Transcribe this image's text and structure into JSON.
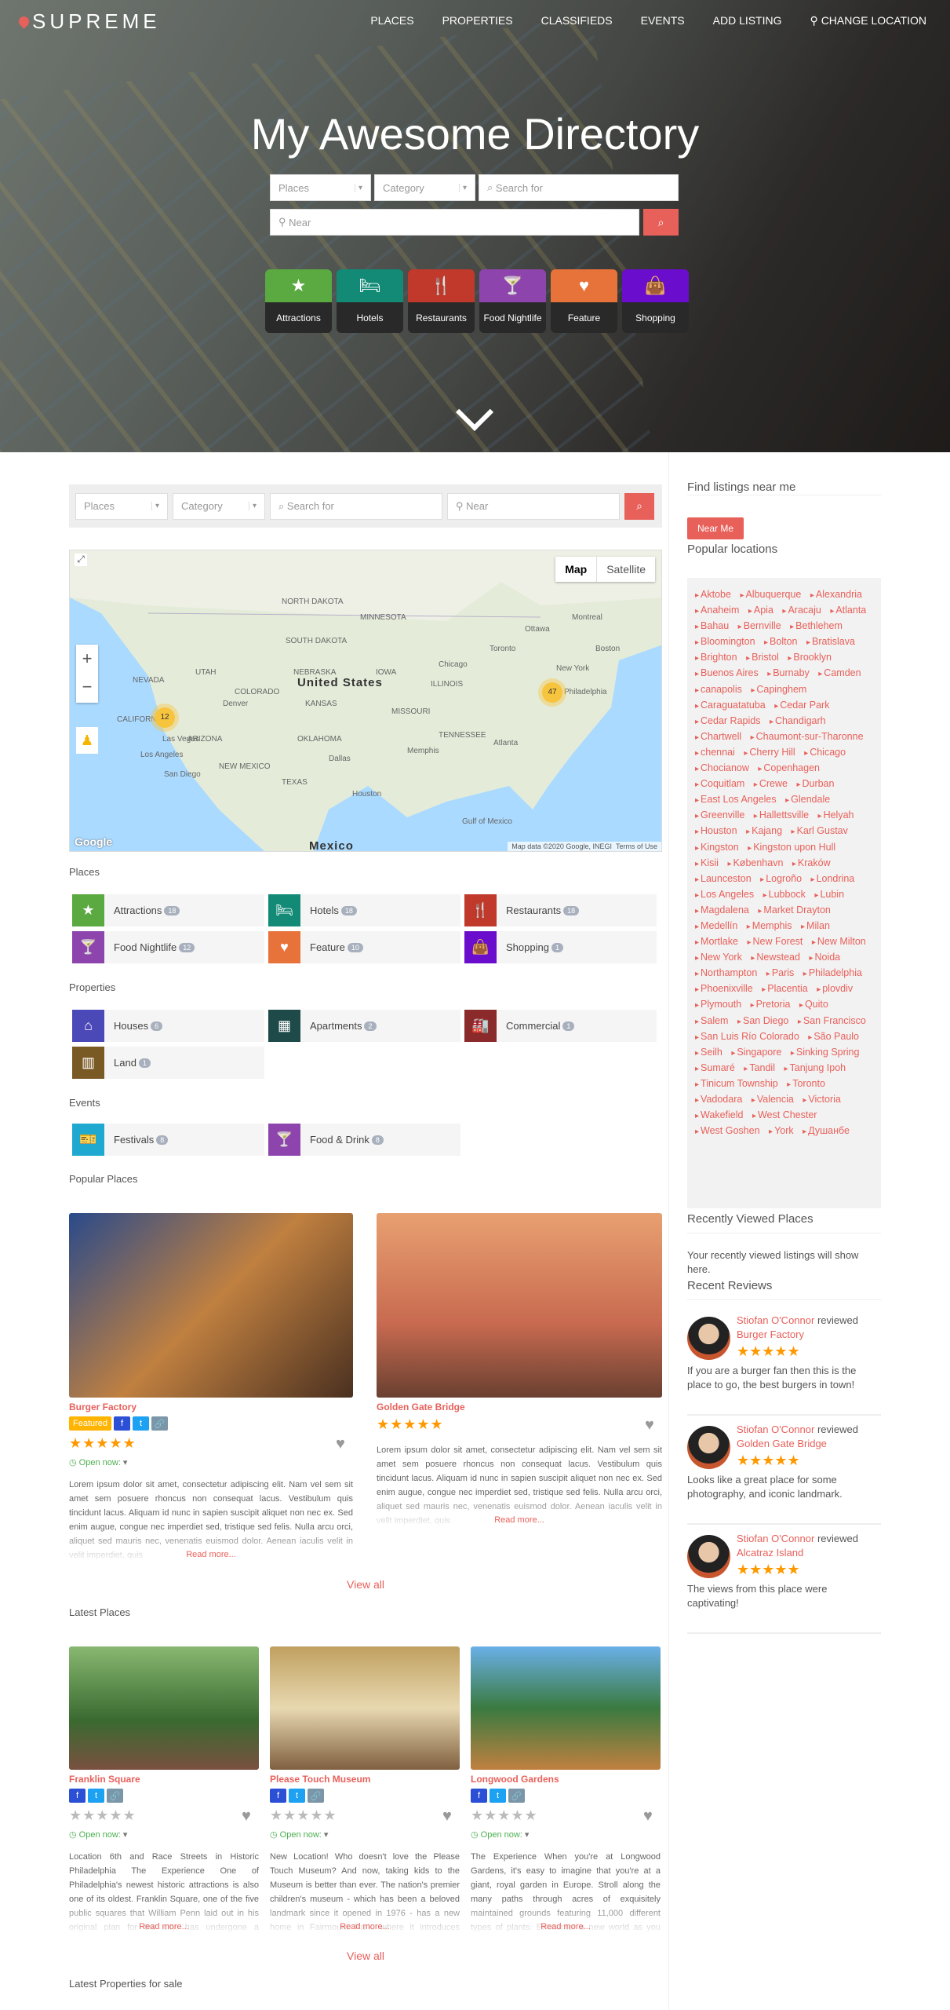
{
  "header": {
    "logo": "SUPREME",
    "nav": [
      "PLACES",
      "PROPERTIES",
      "CLASSIFIEDS",
      "EVENTS",
      "ADD LISTING",
      "CHANGE LOCATION"
    ]
  },
  "hero": {
    "title": "My Awesome Directory",
    "post_type": "Places",
    "category": "Category",
    "search_placeholder": "Search for",
    "near_placeholder": "Near",
    "tiles": [
      {
        "label": "Attractions",
        "icon": "star-icon",
        "color": "#5aa941"
      },
      {
        "label": "Hotels",
        "icon": "bed-icon",
        "color": "#128a76"
      },
      {
        "label": "Restaurants",
        "icon": "utensils-icon",
        "color": "#c0392b"
      },
      {
        "label": "Food Nightlife",
        "icon": "cocktail-icon",
        "color": "#8e44ad"
      },
      {
        "label": "Feature",
        "icon": "heart-icon",
        "color": "#e8733a"
      },
      {
        "label": "Shopping",
        "icon": "shopping-bag-icon",
        "color": "#6a0dcc"
      }
    ]
  },
  "search": {
    "post_type": "Places",
    "category": "Category",
    "search_placeholder": "Search for",
    "near_placeholder": "Near"
  },
  "map": {
    "type_map": "Map",
    "type_satellite": "Satellite",
    "clusters": [
      "12",
      "47"
    ],
    "labels": [
      "United States",
      "Mexico",
      "NORTH DAKOTA",
      "SOUTH DAKOTA",
      "NEBRASKA",
      "KANSAS",
      "OKLAHOMA",
      "TEXAS",
      "NEVADA",
      "UTAH",
      "COLORADO",
      "CALIFORNIA",
      "ARIZONA",
      "NEW MEXICO",
      "MINNESOTA",
      "IOWA",
      "MISSOURI",
      "ILLINOIS",
      "TENNESSEE",
      "Chicago",
      "Toronto",
      "Ottawa",
      "Montreal",
      "Denver",
      "Las Vegas",
      "Los Angeles",
      "San Diego",
      "Dallas",
      "Houston",
      "Atlanta",
      "Memphis",
      "Boston",
      "New York",
      "Philadelphia",
      "Gulf of Mexico"
    ],
    "attribution": "Map data ©2020 Google, INEGI",
    "terms": "Terms of Use",
    "google": "Google"
  },
  "places": {
    "label": "Places",
    "items": [
      {
        "name": "Attractions",
        "count": "18",
        "icon": "star-icon",
        "color": "#5aa941"
      },
      {
        "name": "Hotels",
        "count": "18",
        "icon": "bed-icon",
        "color": "#128a76"
      },
      {
        "name": "Restaurants",
        "count": "18",
        "icon": "utensils-icon",
        "color": "#c0392b"
      },
      {
        "name": "Food Nightlife",
        "count": "12",
        "icon": "cocktail-icon",
        "color": "#8e44ad"
      },
      {
        "name": "Feature",
        "count": "10",
        "icon": "heart-icon",
        "color": "#e8733a"
      },
      {
        "name": "Shopping",
        "count": "1",
        "icon": "shopping-bag-icon",
        "color": "#6a0dcc"
      }
    ]
  },
  "properties": {
    "label": "Properties",
    "items": [
      {
        "name": "Houses",
        "count": "6",
        "icon": "home-icon",
        "color": "#4b48b8"
      },
      {
        "name": "Apartments",
        "count": "2",
        "icon": "building-icon",
        "color": "#1f4a4a"
      },
      {
        "name": "Commercial",
        "count": "1",
        "icon": "industry-icon",
        "color": "#8b2a2a"
      },
      {
        "name": "Land",
        "count": "1",
        "icon": "map-icon",
        "color": "#7a5a24"
      }
    ]
  },
  "events": {
    "label": "Events",
    "items": [
      {
        "name": "Festivals",
        "count": "8",
        "icon": "ticket-icon",
        "color": "#1fa8d0"
      },
      {
        "name": "Food & Drink",
        "count": "8",
        "icon": "cocktail-icon",
        "color": "#8e44ad"
      }
    ]
  },
  "popular": {
    "label": "Popular Places",
    "view_all": "View all",
    "items": [
      {
        "title": "Burger Factory",
        "featured": "Featured",
        "rating": 5,
        "open": "Open now:",
        "desc": "Lorem ipsum dolor sit amet, consectetur adipiscing elit. Nam vel sem sit amet sem posuere rhoncus non consequat lacus. Vestibulum quis tincidunt lacus. Aliquam id nunc in sapien suscipit aliquet non nec ex. Sed enim augue, congue nec imperdiet sed, tristique sed felis. Nulla arcu orci, aliquet sed mauris nec, venenatis euismod dolor. Aenean iaculis velit in velit imperdiet, quis",
        "more": "Read more..."
      },
      {
        "title": "Golden Gate Bridge",
        "rating": 5,
        "desc": "Lorem ipsum dolor sit amet, consectetur adipiscing elit. Nam vel sem sit amet sem posuere rhoncus non consequat lacus. Vestibulum quis tincidunt lacus. Aliquam id nunc in sapien suscipit aliquet non nec ex. Sed enim augue, congue nec imperdiet sed, tristique sed felis. Nulla arcu orci, aliquet sed mauris nec, venenatis euismod dolor. Aenean iaculis velit in velit imperdiet, quis",
        "more": "Read more..."
      }
    ]
  },
  "latest": {
    "label": "Latest Places",
    "view_all": "View all",
    "items": [
      {
        "title": "Franklin Square",
        "rating": 0,
        "open": "Open now:",
        "desc": "Location 6th and Race Streets in Historic Philadelphia The Experience One of Philadelphia's newest historic attractions is also one of its oldest. Franklin Square, one of the five public squares that William Penn laid out in his original plan for the city, has undergone a complete renovation. The",
        "more": "Read more..."
      },
      {
        "title": "Please Touch Museum",
        "rating": 0,
        "open": "Open now:",
        "desc": "New Location! Who doesn't love the Please Touch Museum? And now, taking kids to the Museum is better than ever. The nation's premier children's museum - which has been a beloved landmark since it opened in 1976 - has a new home in Fairmount Park, where it introduces visitors to a world of",
        "more": "Read more..."
      },
      {
        "title": "Longwood Gardens",
        "rating": 0,
        "open": "Open now:",
        "desc": "The Experience When you're at Longwood Gardens, it's easy to imagine that you're at a giant, royal garden in Europe. Stroll along the many paths through acres of exquisitely maintained grounds featuring 11,000 different types of plants. Encounter a new world as you view the tiniest",
        "more": "Read more..."
      }
    ]
  },
  "latest_properties": {
    "label": "Latest Properties for sale"
  },
  "sidebar": {
    "near_title": "Find listings near me",
    "near_button": "Near Me",
    "popular_title": "Popular locations",
    "locations": [
      "Aktobe",
      "Albuquerque",
      "Alexandria",
      "Anaheim",
      "Apia",
      "Aracaju",
      "Atlanta",
      "Bahau",
      "Bernville",
      "Bethlehem",
      "Bloomington",
      "Bolton",
      "Bratislava",
      "Brighton",
      "Bristol",
      "Brooklyn",
      "Buenos Aires",
      "Burnaby",
      "Camden",
      "canapolis",
      "Capinghem",
      "Caraguatatuba",
      "Cedar Park",
      "Cedar Rapids",
      "Chandigarh",
      "Chartwell",
      "Chaumont-sur-Tharonne",
      "chennai",
      "Cherry Hill",
      "Chicago",
      "Chocianow",
      "Copenhagen",
      "Coquitlam",
      "Crewe",
      "Durban",
      "East Los Angeles",
      "Glendale",
      "Greenville",
      "Hallettsville",
      "Helyah",
      "Houston",
      "Kajang",
      "Karl Gustav",
      "Kingston",
      "Kingston upon Hull",
      "Kisii",
      "København",
      "Kraków",
      "Launceston",
      "Logroño",
      "Londrina",
      "Los Angeles",
      "Lubbock",
      "Lubin",
      "Magdalena",
      "Market Drayton",
      "Medellín",
      "Memphis",
      "Milan",
      "Mortlake",
      "New Forest",
      "New Milton",
      "New York",
      "Newstead",
      "Noida",
      "Northampton",
      "Paris",
      "Philadelphia",
      "Phoenixville",
      "Placentia",
      "plovdiv",
      "Plymouth",
      "Pretoria",
      "Quito",
      "Salem",
      "San Diego",
      "San Francisco",
      "San Luis Río Colorado",
      "São Paulo",
      "Seilh",
      "Singapore",
      "Sinking Spring",
      "Sumaré",
      "Tandil",
      "Tanjung Ipoh",
      "Tinicum Township",
      "Toronto",
      "Vadodara",
      "Valencia",
      "Victoria",
      "Wakefield",
      "West Chester",
      "West Goshen",
      "York",
      "Душанбе"
    ],
    "recent_title": "Recently Viewed Places",
    "recent_text": "Your recently viewed listings will show here.",
    "reviews_title": "Recent Reviews",
    "reviews": [
      {
        "author": "Stiofan O'Connor",
        "verb": "reviewed",
        "place": "Burger Factory",
        "rating": 5,
        "text": "If you are a burger fan then this is the place to go, the best burgers in town!"
      },
      {
        "author": "Stiofan O'Connor",
        "verb": "reviewed",
        "place": "Golden Gate Bridge",
        "rating": 5,
        "text": "Looks like a great place for some photography, and iconic landmark."
      },
      {
        "author": "Stiofan O'Connor",
        "verb": "reviewed",
        "place": "Alcatraz Island",
        "rating": 5,
        "text": "The views from this place were captivating!"
      }
    ]
  },
  "colors": {
    "accent": "#e8605a",
    "star": "#ff9800",
    "facebook": "#2b50d6",
    "twitter": "#1da1f2",
    "link": "#7a96a8",
    "featured": "#ffb400",
    "open": "#4caf50"
  }
}
